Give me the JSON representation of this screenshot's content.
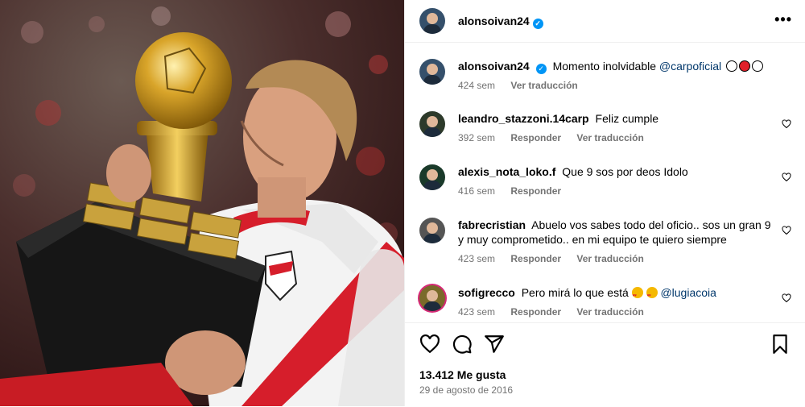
{
  "post": {
    "username": "alonsoivan24",
    "more_label": "•••"
  },
  "caption": {
    "username": "alonsoivan24",
    "text": "Momento inolvidable",
    "mention": "@carpoficial",
    "time": "424 sem",
    "translate": "Ver traducción"
  },
  "comments": [
    {
      "username": "leandro_stazzoni.14carp",
      "text": "Feliz cumple",
      "time": "392 sem",
      "reply": "Responder",
      "translate": "Ver traducción"
    },
    {
      "username": "alexis_nota_loko.f",
      "text": "Que 9 sos por deos Idolo",
      "time": "416 sem",
      "reply": "Responder"
    },
    {
      "username": "fabrecristian",
      "text": "Abuelo vos sabes todo del oficio.. sos un gran 9 y muy comprometido.. en mi equipo te quiero siempre",
      "time": "423 sem",
      "reply": "Responder",
      "translate": "Ver traducción"
    },
    {
      "username": "sofigrecco",
      "text": "Pero mirá lo que está",
      "mention": "@lugiacoia",
      "time": "423 sem",
      "reply": "Responder",
      "translate": "Ver traducción"
    }
  ],
  "likes": "13.412 Me gusta",
  "date": "29 de agosto de 2016",
  "icons": [
    "heart-icon",
    "comment-icon",
    "share-icon",
    "bookmark-icon",
    "verified-icon",
    "more-icon"
  ]
}
